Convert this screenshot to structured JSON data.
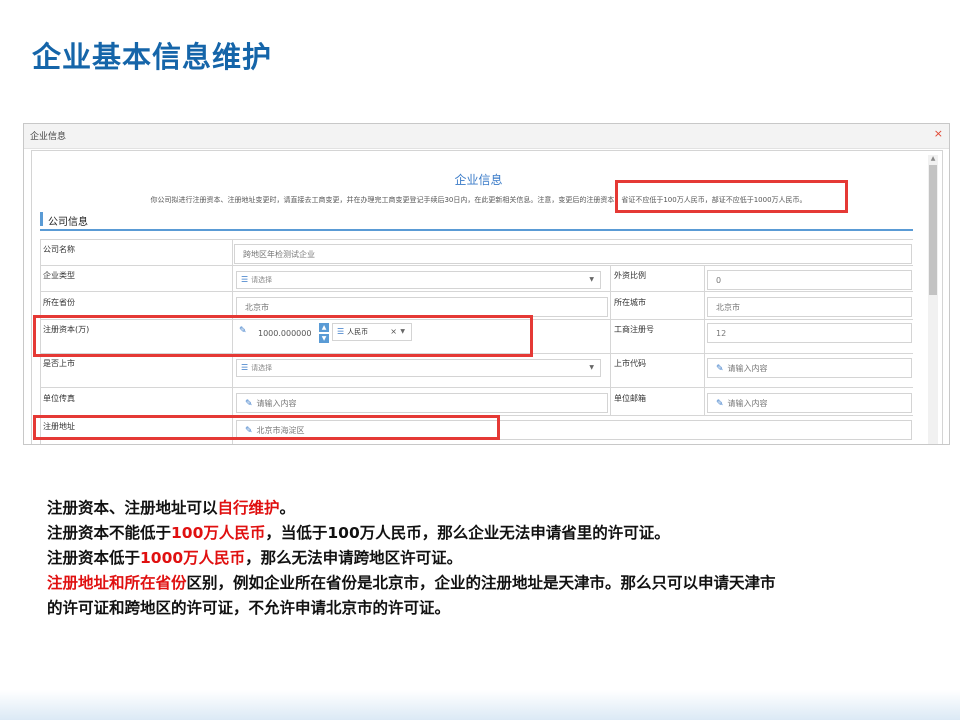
{
  "slide": {
    "title": "企业基本信息维护"
  },
  "window": {
    "title": "企业信息",
    "close_glyph": "×"
  },
  "form": {
    "title": "企业信息",
    "notice": "你公司拟进行注册资本、注册地址变更时，请直接去工商变更，并在办理完工商变更登记手续后30日内，在此更新相关信息。注意，变更后的注册资本，省证不应低于100万人民币，部证不应低于1000万人民币。",
    "section": "公司信息",
    "fields": {
      "company_name": {
        "label": "公司名称",
        "value": "跨地区年检测试企业"
      },
      "company_type": {
        "label": "企业类型",
        "value": "请选择"
      },
      "foreign_ratio": {
        "label": "外资比例",
        "value": "0"
      },
      "province": {
        "label": "所在省份",
        "value": "北京市"
      },
      "city": {
        "label": "所在城市",
        "value": "北京市"
      },
      "capital": {
        "label": "注册资本(万)",
        "value": "1000.000000",
        "currency": "人民币",
        "clear": "×"
      },
      "reg_no": {
        "label": "工商注册号",
        "value": "12"
      },
      "listed": {
        "label": "是否上市",
        "value": "请选择"
      },
      "stock_code": {
        "label": "上市代码",
        "placeholder": "请输入内容"
      },
      "fax": {
        "label": "单位传真",
        "placeholder": "请输入内容"
      },
      "email": {
        "label": "单位邮箱",
        "placeholder": "请输入内容"
      },
      "address": {
        "label": "注册地址",
        "value": "北京市海淀区"
      }
    }
  },
  "description": {
    "line1": {
      "a": "注册资本、注册地址可以",
      "b": "自行维护",
      "c": "。"
    },
    "line2": {
      "a": "注册资本不能低于",
      "b": "100万人民币",
      "c": "，当低于100万人民币，那么企业无法申请省里的许可证。"
    },
    "line3": {
      "a": "注册资本低于",
      "b": "1000万人民币",
      "c": "，那么无法申请跨地区许可证。"
    },
    "line4": {
      "a": "注册地址和所在省份",
      "b": "区别，例如企业所在省份是北京市，企业的注册地址是天津市。那么只可以申请天津市"
    },
    "line5": {
      "a": "的许可证和跨地区的许可证，不允许申请北京市的许可证。"
    }
  },
  "colors": {
    "title_blue": "#1565a9",
    "highlight_red": "#e53935",
    "accent_blue": "#5a9bd5"
  }
}
